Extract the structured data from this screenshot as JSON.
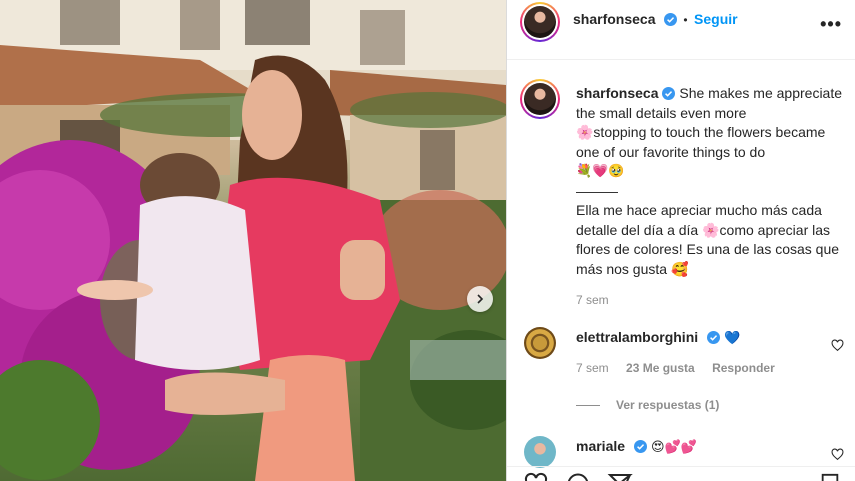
{
  "post": {
    "author": "sharfonseca",
    "follow_label": "Seguir",
    "more_label": "•••",
    "dot": "•"
  },
  "caption": {
    "author": "sharfonseca",
    "line1": "She makes me appreciate the small details even more",
    "line2": "🌸stopping to touch the flowers became one of our favorite things to do",
    "line3": "💐💗🥹",
    "separator": "———",
    "line4": "Ella me hace apreciar mucho más cada detalle del día a día 🌸como apreciar las flores de colores! Es una de las cosas que más nos gusta 🥰",
    "time": "7 sem"
  },
  "comments": [
    {
      "author": "elettralamborghini",
      "text": "💙",
      "time": "7 sem",
      "likes": "23 Me gusta",
      "reply_label": "Responder"
    },
    {
      "author": "mariale",
      "text": "😍💕💕"
    }
  ],
  "view_replies": "Ver respuestas (1)",
  "colors": {
    "accent": "#0095f6",
    "verified": "#3897f0",
    "muted": "#8e8e8e",
    "heart_blue": "#2f6ed8"
  },
  "icons": [
    "chevron-right-icon",
    "verified-badge-icon",
    "more-icon",
    "heart-icon",
    "comment-icon",
    "share-icon",
    "bookmark-icon"
  ]
}
